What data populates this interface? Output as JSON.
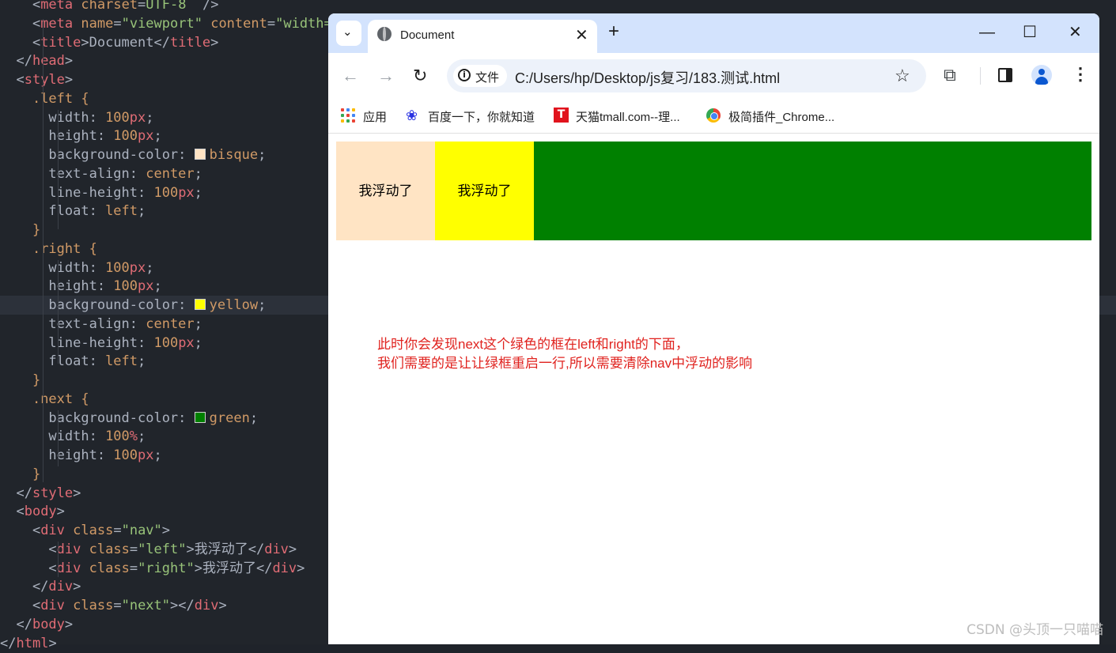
{
  "editor": {
    "lines": [
      [
        [
          "t-punc",
          "    <"
        ],
        [
          "t-tag",
          "meta"
        ],
        [
          "t-punc",
          " "
        ],
        [
          "t-attr",
          "charset"
        ],
        [
          "t-punc",
          "="
        ],
        [
          "t-str",
          "UTF-8"
        ],
        [
          "t-punc",
          "  />"
        ]
      ],
      [
        [
          "t-punc",
          "    <"
        ],
        [
          "t-tag",
          "meta"
        ],
        [
          "t-punc",
          " "
        ],
        [
          "t-attr",
          "name"
        ],
        [
          "t-punc",
          "="
        ],
        [
          "t-str",
          "\"viewport\""
        ],
        [
          "t-punc",
          " "
        ],
        [
          "t-attr",
          "content"
        ],
        [
          "t-punc",
          "="
        ],
        [
          "t-str",
          "\"width="
        ]
      ],
      [
        [
          "t-punc",
          "    <"
        ],
        [
          "t-tag",
          "title"
        ],
        [
          "t-punc",
          ">Document</"
        ],
        [
          "t-tag",
          "title"
        ],
        [
          "t-punc",
          ">"
        ]
      ],
      [
        [
          "t-punc",
          "  </"
        ],
        [
          "t-tag",
          "head"
        ],
        [
          "t-punc",
          ">"
        ]
      ],
      [
        [
          "t-punc",
          "  <"
        ],
        [
          "t-tag",
          "style"
        ],
        [
          "t-punc",
          ">"
        ]
      ],
      [
        [
          "t-punc",
          "    "
        ],
        [
          "t-sel",
          ".left {"
        ]
      ],
      [
        [
          "t-prop",
          "      width: "
        ],
        [
          "t-num",
          "100"
        ],
        [
          "t-unit",
          "px"
        ],
        [
          "t-punc",
          ";"
        ]
      ],
      [
        [
          "t-prop",
          "      height: "
        ],
        [
          "t-num",
          "100"
        ],
        [
          "t-unit",
          "px"
        ],
        [
          "t-punc",
          ";"
        ]
      ],
      [
        [
          "t-prop",
          "      background-color: "
        ],
        [
          "swatch",
          "#ffe4c4"
        ],
        [
          "t-val",
          "bisque"
        ],
        [
          "t-punc",
          ";"
        ]
      ],
      [
        [
          "t-prop",
          "      text-align: "
        ],
        [
          "t-val",
          "center"
        ],
        [
          "t-punc",
          ";"
        ]
      ],
      [
        [
          "t-prop",
          "      line-height: "
        ],
        [
          "t-num",
          "100"
        ],
        [
          "t-unit",
          "px"
        ],
        [
          "t-punc",
          ";"
        ]
      ],
      [
        [
          "t-prop",
          "      float: "
        ],
        [
          "t-val",
          "left"
        ],
        [
          "t-punc",
          ";"
        ]
      ],
      [
        [
          "t-punc",
          "    "
        ],
        [
          "t-sel",
          "}"
        ]
      ],
      [
        [
          "t-punc",
          "    "
        ],
        [
          "t-sel",
          ".right {"
        ]
      ],
      [
        [
          "t-prop",
          "      width: "
        ],
        [
          "t-num",
          "100"
        ],
        [
          "t-unit",
          "px"
        ],
        [
          "t-punc",
          ";"
        ]
      ],
      [
        [
          "t-prop",
          "      height: "
        ],
        [
          "t-num",
          "100"
        ],
        [
          "t-unit",
          "px"
        ],
        [
          "t-punc",
          ";"
        ]
      ],
      [
        [
          "t-prop",
          "      background-color: "
        ],
        [
          "swatch",
          "#ffff00"
        ],
        [
          "t-val",
          "yellow"
        ],
        [
          "t-punc",
          ";"
        ]
      ],
      [
        [
          "t-prop",
          "      text-align: "
        ],
        [
          "t-val",
          "center"
        ],
        [
          "t-punc",
          ";"
        ]
      ],
      [
        [
          "t-prop",
          "      line-height: "
        ],
        [
          "t-num",
          "100"
        ],
        [
          "t-unit",
          "px"
        ],
        [
          "t-punc",
          ";"
        ]
      ],
      [
        [
          "t-prop",
          "      float: "
        ],
        [
          "t-val",
          "left"
        ],
        [
          "t-punc",
          ";"
        ]
      ],
      [
        [
          "t-punc",
          "    "
        ],
        [
          "t-sel",
          "}"
        ]
      ],
      [
        [
          "t-punc",
          "    "
        ],
        [
          "t-sel",
          ".next {"
        ]
      ],
      [
        [
          "t-prop",
          "      background-color: "
        ],
        [
          "swatch",
          "#008000"
        ],
        [
          "t-val",
          "green"
        ],
        [
          "t-punc",
          ";"
        ]
      ],
      [
        [
          "t-prop",
          "      width: "
        ],
        [
          "t-num",
          "100"
        ],
        [
          "t-unit",
          "%"
        ],
        [
          "t-punc",
          ";"
        ]
      ],
      [
        [
          "t-prop",
          "      height: "
        ],
        [
          "t-num",
          "100"
        ],
        [
          "t-unit",
          "px"
        ],
        [
          "t-punc",
          ";"
        ]
      ],
      [
        [
          "t-punc",
          "    "
        ],
        [
          "t-sel",
          "}"
        ]
      ],
      [
        [
          "t-punc",
          "  </"
        ],
        [
          "t-tag",
          "style"
        ],
        [
          "t-punc",
          ">"
        ]
      ],
      [
        [
          "t-punc",
          "  <"
        ],
        [
          "t-tag",
          "body"
        ],
        [
          "t-punc",
          ">"
        ]
      ],
      [
        [
          "t-punc",
          "    <"
        ],
        [
          "t-tag",
          "div"
        ],
        [
          "t-punc",
          " "
        ],
        [
          "t-attr",
          "class"
        ],
        [
          "t-punc",
          "="
        ],
        [
          "t-str",
          "\"nav\""
        ],
        [
          "t-punc",
          ">"
        ]
      ],
      [
        [
          "t-punc",
          "      <"
        ],
        [
          "t-tag",
          "div"
        ],
        [
          "t-punc",
          " "
        ],
        [
          "t-attr",
          "class"
        ],
        [
          "t-punc",
          "="
        ],
        [
          "t-str",
          "\"left\""
        ],
        [
          "t-punc",
          ">我浮动了</"
        ],
        [
          "t-tag",
          "div"
        ],
        [
          "t-punc",
          ">"
        ]
      ],
      [
        [
          "t-punc",
          "      <"
        ],
        [
          "t-tag",
          "div"
        ],
        [
          "t-punc",
          " "
        ],
        [
          "t-attr",
          "class"
        ],
        [
          "t-punc",
          "="
        ],
        [
          "t-str",
          "\"right\""
        ],
        [
          "t-punc",
          ">我浮动了</"
        ],
        [
          "t-tag",
          "div"
        ],
        [
          "t-punc",
          ">"
        ]
      ],
      [
        [
          "t-punc",
          "    </"
        ],
        [
          "t-tag",
          "div"
        ],
        [
          "t-punc",
          ">"
        ]
      ],
      [
        [
          "t-punc",
          "    <"
        ],
        [
          "t-tag",
          "div"
        ],
        [
          "t-punc",
          " "
        ],
        [
          "t-attr",
          "class"
        ],
        [
          "t-punc",
          "="
        ],
        [
          "t-str",
          "\"next\""
        ],
        [
          "t-punc",
          "></"
        ],
        [
          "t-tag",
          "div"
        ],
        [
          "t-punc",
          ">"
        ]
      ],
      [
        [
          "t-punc",
          "  </"
        ],
        [
          "t-tag",
          "body"
        ],
        [
          "t-punc",
          ">"
        ]
      ],
      [
        [
          "t-punc",
          "</"
        ],
        [
          "t-tag",
          "html"
        ],
        [
          "t-punc",
          ">"
        ]
      ]
    ],
    "highlight_line": 16
  },
  "browser": {
    "tab_title": "Document",
    "tab_close": "✕",
    "new_tab": "+",
    "tab_menu": "⌄",
    "window": {
      "minimize": "—",
      "maximize": "☐",
      "close": "✕"
    },
    "nav": {
      "back": "←",
      "forward": "→",
      "reload": "↻"
    },
    "omnibox": {
      "secure_label": "文件",
      "url": "C:/Users/hp/Desktop/js复习/183.测试.html",
      "star": "☆"
    },
    "extensions": "⧉",
    "kebab": "⋮",
    "bookmarks": [
      {
        "label": "应用",
        "icon": "apps-icon"
      },
      {
        "label": "百度一下，你就知道",
        "icon": "baidu-icon"
      },
      {
        "label": "天猫tmall.com--理...",
        "icon": "tmall-icon"
      },
      {
        "label": "极简插件_Chrome...",
        "icon": "chrome-icon"
      }
    ],
    "tmall_glyph": "T",
    "baidu_glyph": "❀"
  },
  "page": {
    "left_text": "我浮动了",
    "right_text": "我浮动了",
    "colors": {
      "left": "#ffe4c4",
      "right": "#ffff00",
      "next": "#008000",
      "note": "#e0231f"
    },
    "note_line1": "此时你会发现next这个绿色的框在left和right的下面，",
    "note_line2": "我们需要的是让让绿框重启一行,所以需要清除nav中浮动的影响"
  },
  "watermark": "CSDN @头顶一只喵喵"
}
